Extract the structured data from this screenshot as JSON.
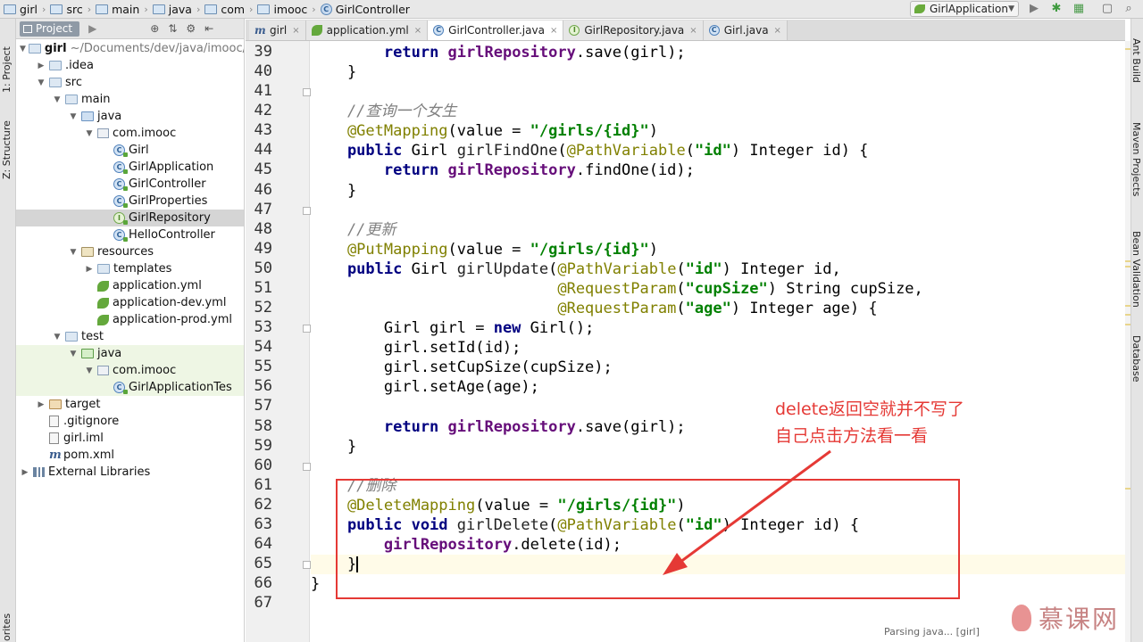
{
  "breadcrumbs": [
    {
      "label": "girl",
      "icon": "folder-icon"
    },
    {
      "label": "src",
      "icon": "folder-icon"
    },
    {
      "label": "main",
      "icon": "folder-icon"
    },
    {
      "label": "java",
      "icon": "folder-icon"
    },
    {
      "label": "com",
      "icon": "folder-icon"
    },
    {
      "label": "imooc",
      "icon": "folder-icon"
    },
    {
      "label": "GirlController",
      "icon": "class-icon"
    }
  ],
  "run_config": {
    "label": "GirlApplication"
  },
  "side_tools": {
    "project": "1: Project",
    "structure": "Z: Structure",
    "favorites": "orites"
  },
  "right_tools": {
    "ant": "Ant Build",
    "maven": "Maven Projects",
    "bean": "Bean Validation",
    "database": "Database"
  },
  "project_panel": {
    "tab_label": "Project",
    "root_label": "girl",
    "root_path": "~/Documents/dev/java/imooc/",
    "tree": [
      {
        "label": "girl",
        "extra": "~/Documents/dev/java/imooc/",
        "indent": 0,
        "arrow": "down",
        "icon": "folder-icon"
      },
      {
        "label": ".idea",
        "indent": 1,
        "arrow": "right",
        "icon": "folder-icon"
      },
      {
        "label": "src",
        "indent": 1,
        "arrow": "down",
        "icon": "folder-icon"
      },
      {
        "label": "main",
        "indent": 2,
        "arrow": "down",
        "icon": "folder-icon"
      },
      {
        "label": "java",
        "indent": 3,
        "arrow": "down",
        "icon": "source-folder-icon"
      },
      {
        "label": "com.imooc",
        "indent": 4,
        "arrow": "down",
        "icon": "package-icon"
      },
      {
        "label": "Girl",
        "indent": 5,
        "arrow": "",
        "icon": "class-icon"
      },
      {
        "label": "GirlApplication",
        "indent": 5,
        "arrow": "",
        "icon": "class-icon"
      },
      {
        "label": "GirlController",
        "indent": 5,
        "arrow": "",
        "icon": "class-icon"
      },
      {
        "label": "GirlProperties",
        "indent": 5,
        "arrow": "",
        "icon": "class-icon"
      },
      {
        "label": "GirlRepository",
        "indent": 5,
        "arrow": "",
        "icon": "interface-icon",
        "selected": true
      },
      {
        "label": "HelloController",
        "indent": 5,
        "arrow": "",
        "icon": "class-icon"
      },
      {
        "label": "resources",
        "indent": 3,
        "arrow": "down",
        "icon": "resources-folder-icon"
      },
      {
        "label": "templates",
        "indent": 4,
        "arrow": "right",
        "icon": "folder-icon"
      },
      {
        "label": "application.yml",
        "indent": 4,
        "arrow": "",
        "icon": "yml-icon"
      },
      {
        "label": "application-dev.yml",
        "indent": 4,
        "arrow": "",
        "icon": "yml-icon"
      },
      {
        "label": "application-prod.yml",
        "indent": 4,
        "arrow": "",
        "icon": "yml-icon"
      },
      {
        "label": "test",
        "indent": 2,
        "arrow": "down",
        "icon": "folder-icon"
      },
      {
        "label": "java",
        "indent": 3,
        "arrow": "down",
        "icon": "test-folder-icon",
        "tested": true
      },
      {
        "label": "com.imooc",
        "indent": 4,
        "arrow": "down",
        "icon": "package-icon",
        "tested": true
      },
      {
        "label": "GirlApplicationTes",
        "indent": 5,
        "arrow": "",
        "icon": "class-icon",
        "tested": true
      },
      {
        "label": "target",
        "indent": 1,
        "arrow": "right",
        "icon": "excluded-folder-icon"
      },
      {
        "label": ".gitignore",
        "indent": 1,
        "arrow": "",
        "icon": "file-icon"
      },
      {
        "label": "girl.iml",
        "indent": 1,
        "arrow": "",
        "icon": "file-icon"
      },
      {
        "label": "pom.xml",
        "indent": 1,
        "arrow": "",
        "icon": "maven-icon"
      },
      {
        "label": "External Libraries",
        "indent": 0,
        "arrow": "right",
        "icon": "library-icon"
      }
    ]
  },
  "editor_tabs": [
    {
      "label": "girl",
      "icon": "maven-icon",
      "active": false
    },
    {
      "label": "application.yml",
      "icon": "yml-icon",
      "active": false
    },
    {
      "label": "GirlController.java",
      "icon": "class-icon",
      "active": true
    },
    {
      "label": "GirlRepository.java",
      "icon": "interface-icon",
      "active": false
    },
    {
      "label": "Girl.java",
      "icon": "class-icon",
      "active": false
    }
  ],
  "code": {
    "first_line": 39,
    "current_line": 65,
    "lines": [
      [
        [
          "pl",
          "        "
        ],
        [
          "kw",
          "return "
        ],
        [
          "fd",
          "girlRepository"
        ],
        [
          "pl",
          ".save(girl);"
        ]
      ],
      [
        [
          "pl",
          "    }"
        ]
      ],
      [
        [
          "pl",
          ""
        ]
      ],
      [
        [
          "cm",
          "    //查询一个女生"
        ]
      ],
      [
        [
          "an",
          "    @GetMapping"
        ],
        [
          "pl",
          "(value = "
        ],
        [
          "st",
          "\"/girls/{id}\""
        ],
        [
          "pl",
          ")"
        ]
      ],
      [
        [
          "kw",
          "    public "
        ],
        [
          "pl",
          "Girl "
        ],
        [
          "mt",
          "girlFindOne"
        ],
        [
          "pl",
          "("
        ],
        [
          "an",
          "@PathVariable"
        ],
        [
          "pl",
          "("
        ],
        [
          "st",
          "\"id\""
        ],
        [
          "pl",
          ") Integer id) {"
        ]
      ],
      [
        [
          "kw",
          "        return "
        ],
        [
          "fd",
          "girlRepository"
        ],
        [
          "pl",
          ".findOne(id);"
        ]
      ],
      [
        [
          "pl",
          "    }"
        ]
      ],
      [
        [
          "pl",
          ""
        ]
      ],
      [
        [
          "cm",
          "    //更新"
        ]
      ],
      [
        [
          "an",
          "    @PutMapping"
        ],
        [
          "pl",
          "(value = "
        ],
        [
          "st",
          "\"/girls/{id}\""
        ],
        [
          "pl",
          ")"
        ]
      ],
      [
        [
          "kw",
          "    public "
        ],
        [
          "pl",
          "Girl "
        ],
        [
          "mt",
          "girlUpdate"
        ],
        [
          "pl",
          "("
        ],
        [
          "an",
          "@PathVariable"
        ],
        [
          "pl",
          "("
        ],
        [
          "st",
          "\"id\""
        ],
        [
          "pl",
          ") Integer id,"
        ]
      ],
      [
        [
          "pl",
          "                           "
        ],
        [
          "an",
          "@RequestParam"
        ],
        [
          "pl",
          "("
        ],
        [
          "st",
          "\"cupSize\""
        ],
        [
          "pl",
          ") String cupSize,"
        ]
      ],
      [
        [
          "pl",
          "                           "
        ],
        [
          "an",
          "@RequestParam"
        ],
        [
          "pl",
          "("
        ],
        [
          "st",
          "\"age\""
        ],
        [
          "pl",
          ") Integer age) {"
        ]
      ],
      [
        [
          "pl",
          "        Girl girl = "
        ],
        [
          "kw",
          "new "
        ],
        [
          "pl",
          "Girl();"
        ]
      ],
      [
        [
          "pl",
          "        girl.setId(id);"
        ]
      ],
      [
        [
          "pl",
          "        girl.setCupSize(cupSize);"
        ]
      ],
      [
        [
          "pl",
          "        girl.setAge(age);"
        ]
      ],
      [
        [
          "pl",
          ""
        ]
      ],
      [
        [
          "kw",
          "        return "
        ],
        [
          "fd",
          "girlRepository"
        ],
        [
          "pl",
          ".save(girl);"
        ]
      ],
      [
        [
          "pl",
          "    }"
        ]
      ],
      [
        [
          "pl",
          ""
        ]
      ],
      [
        [
          "cm",
          "    //删除"
        ]
      ],
      [
        [
          "an",
          "    @DeleteMapping"
        ],
        [
          "pl",
          "(value = "
        ],
        [
          "st",
          "\"/girls/{id}\""
        ],
        [
          "pl",
          ")"
        ]
      ],
      [
        [
          "kw",
          "    public void "
        ],
        [
          "mt",
          "girlDelete"
        ],
        [
          "pl",
          "("
        ],
        [
          "an",
          "@PathVariable"
        ],
        [
          "pl",
          "("
        ],
        [
          "st",
          "\"id\""
        ],
        [
          "pl",
          ") Integer id) {"
        ]
      ],
      [
        [
          "pl",
          "        "
        ],
        [
          "fd",
          "girlRepository"
        ],
        [
          "pl",
          ".delete(id);"
        ]
      ],
      [
        [
          "pl",
          "    }"
        ]
      ],
      [
        [
          "pl",
          "}"
        ]
      ],
      [
        [
          "pl",
          ""
        ]
      ]
    ]
  },
  "annotation": {
    "line1": "delete返回空就并不写了",
    "line2": "自己点击方法看一看",
    "color": "#e53935"
  },
  "status": {
    "text": "Parsing java... [girl]"
  },
  "watermark": {
    "text": "慕课网"
  }
}
